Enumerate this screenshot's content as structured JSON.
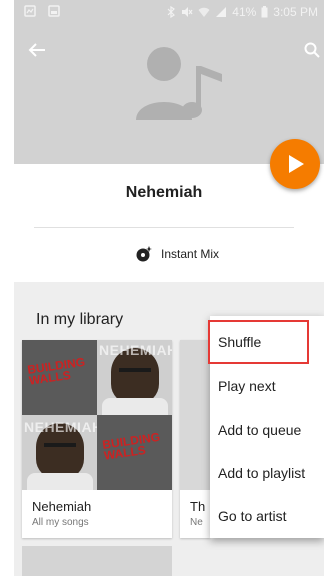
{
  "status_bar": {
    "battery": "41%",
    "time": "3:05 PM"
  },
  "header": {
    "back_icon": "arrow-back-icon",
    "search_icon": "search-icon",
    "placeholder_icon": "artist-placeholder-icon"
  },
  "artist": {
    "name": "Nehemiah"
  },
  "instant_mix": {
    "label": "Instant Mix",
    "icon": "instant-mix-icon"
  },
  "library": {
    "title": "In my library",
    "cards": [
      {
        "title": "Nehemiah",
        "subtitle": "All my songs",
        "art_overlay_top": "NEHEMIAH",
        "art_overlay_mid": "NEHEMIAH",
        "art_red_text": "BUILDING WALLS"
      },
      {
        "title": "Th",
        "subtitle": "Ne"
      }
    ]
  },
  "context_menu": {
    "items": [
      {
        "label": "Shuffle",
        "highlighted": true
      },
      {
        "label": "Play next"
      },
      {
        "label": "Add to queue"
      },
      {
        "label": "Add to playlist"
      },
      {
        "label": "Go to artist"
      }
    ]
  },
  "colors": {
    "accent": "#f57c00",
    "highlight": "#e53935"
  }
}
